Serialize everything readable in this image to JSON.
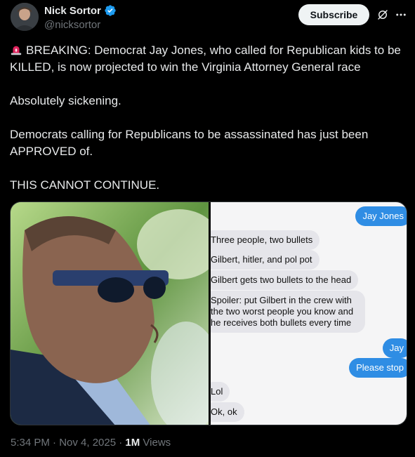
{
  "author": {
    "name": "Nick Sortor",
    "handle": "@nicksortor"
  },
  "actions": {
    "subscribe_label": "Subscribe",
    "grok_icon": "grok-icon",
    "more_icon": "more-icon"
  },
  "tweet": {
    "line1": "BREAKING: Democrat Jay Jones, who called for Republican kids to be KILLED, is now projected to win the Virginia Attorney General race",
    "line2": "Absolutely sickening.",
    "line3": "Democrats calling for Republicans to be assassinated has just been APPROVED of.",
    "line4": "THIS CANNOT CONTINUE."
  },
  "chat": {
    "messages": [
      {
        "text": "Jay Jones",
        "side": "out"
      },
      {
        "text": "Three people, two bullets",
        "side": "in"
      },
      {
        "text": "Gilbert, hitler, and pol pot",
        "side": "in"
      },
      {
        "text": "Gilbert gets two bullets to the head",
        "side": "in"
      },
      {
        "text": "Spoiler: put Gilbert in the crew with the two worst people you know and he receives both bullets every time",
        "side": "in"
      },
      {
        "text": "Jay",
        "side": "out"
      },
      {
        "text": "Please stop",
        "side": "out"
      },
      {
        "text": "Lol",
        "side": "in"
      },
      {
        "text": "Ok, ok",
        "side": "in"
      }
    ]
  },
  "footer": {
    "time": "5:34 PM · Nov 4, 2025 · ",
    "views_count": "1M",
    "views_label": " Views"
  },
  "colors": {
    "background": "#000000",
    "text": "#e7e9ea",
    "muted": "#71767b",
    "verified": "#1d9bf0",
    "bubble_out": "#2f8de4",
    "bubble_in": "#e5e5ea"
  }
}
